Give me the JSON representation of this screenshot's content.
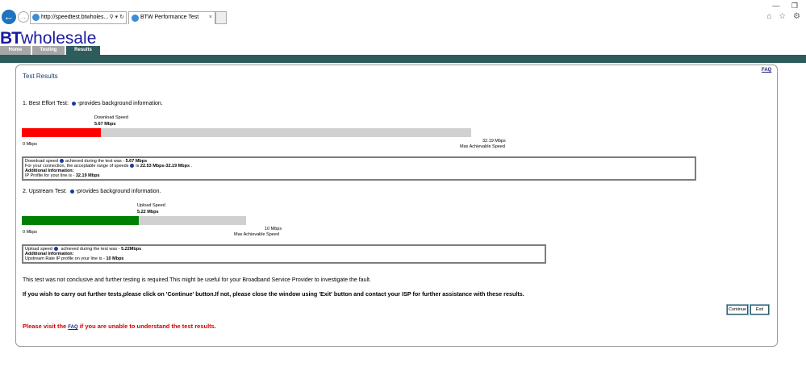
{
  "browser": {
    "back_icon": "back-arrow-icon",
    "forward_icon": "forward-arrow-icon",
    "address": "http://speedtest.btwholes...",
    "address_controls": "⚲ ▾ ↻",
    "tab_title": "BTW Performance Test",
    "tab_close": "×",
    "window_controls": "— ❐",
    "tools": "⌂ ☆ ⚙"
  },
  "brand": {
    "bt": "BT",
    "wholesale": "wholesale"
  },
  "nav": {
    "home": "Home",
    "testing": "Testing",
    "results": "Results"
  },
  "faq_top": "FAQ",
  "results": {
    "title": "Test Results",
    "download": {
      "heading_prefix": "1. Best Effort Test:",
      "heading_suffix": "-provides background information.",
      "speed_label": "Download Speed",
      "speed_value": "5.67 Mbps",
      "measured": 5.67,
      "max": 32.19,
      "min_label": "0 Mbps",
      "max_label": "32.19 Mbps",
      "max_caption": "Max Achievable Speed",
      "bar_color": "#ff0000",
      "box_line1_prefix": "Download speed",
      "box_line1_mid": "achieved during the test was - ",
      "box_line1_value": "5.67 Mbps",
      "box_line2_prefix": "For your connection, the acceptable range of speeds",
      "box_line2_mid": "is ",
      "box_line2_value": "22.53 Mbps-32.19 Mbps",
      "box_line2_suffix": " .",
      "box_line3": "Additional Information:",
      "box_line4_prefix": "IP Profile for your line is - ",
      "box_line4_value": "32.19 Mbps"
    },
    "upload": {
      "heading_prefix": "2. Upstream Test:",
      "heading_suffix": "-provides background information.",
      "speed_label": "Upload Speed",
      "speed_value": "5.22 Mbps",
      "measured": 5.22,
      "max": 10,
      "min_label": "0 Mbps",
      "max_label": "10 Mbps",
      "max_caption": "Max Achievable Speed",
      "bar_color": "#008000",
      "box_line1_prefix": "Upload speed",
      "box_line1_mid": " achieved during the test was - ",
      "box_line1_value": "5.22Mbps",
      "box_line2": "Additional Information:",
      "box_line3_prefix": "Upstream Rate IP profile on your line is - ",
      "box_line3_value": "10 Mbps"
    },
    "message1": "This test was not conclusive and further testing is required.This might be useful for your Broadband Service Provider to investigate the fault.",
    "message2": "If you wish to carry out further tests,please click on 'Continue' button.If not, please close the window using 'Exit' button and contact your ISP for further assistance with these results.",
    "continue_label": "Continue",
    "exit_label": "Exit",
    "visit_prefix": "Please visit the ",
    "visit_link": "FAQ",
    "visit_suffix": " if you are unable to understand the test results."
  }
}
